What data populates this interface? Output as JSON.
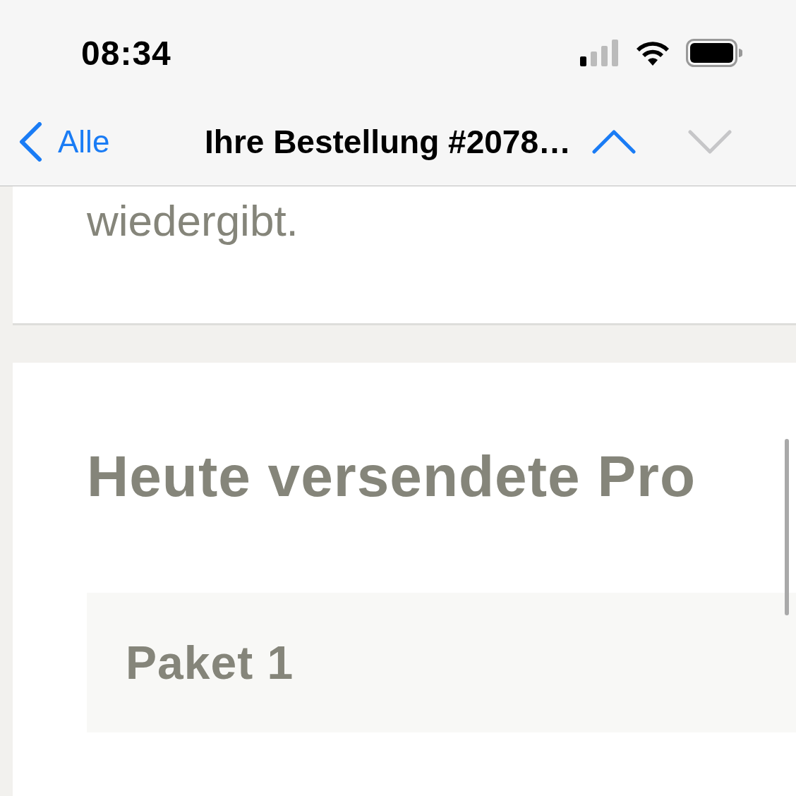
{
  "status_bar": {
    "time": "08:34"
  },
  "nav": {
    "back_label": "Alle",
    "title": "Ihre Bestellung #2078…",
    "arrows": [
      {
        "kind": "up",
        "disabled": false
      },
      {
        "kind": "down",
        "disabled": true
      }
    ]
  },
  "message": {
    "previous_text": "wiedergibt.",
    "heading": "Heute versendete Pro",
    "package": {
      "title": "Paket 1"
    }
  }
}
